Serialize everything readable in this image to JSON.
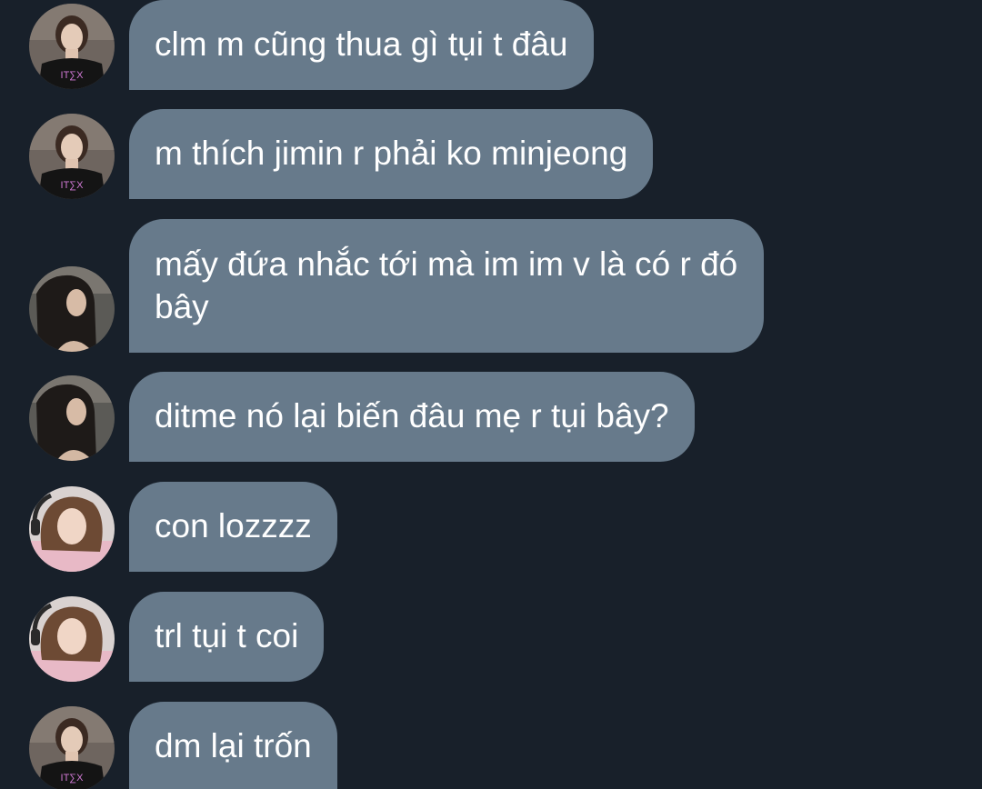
{
  "messages": [
    {
      "text": "clm m cũng thua gì tụi t đâu",
      "avatar": "avatar-black-tee-girl"
    },
    {
      "text": "m thích jimin r phải ko minjeong",
      "avatar": "avatar-black-tee-girl"
    },
    {
      "text": "mấy đứa nhắc tới mà im im v là có r đó bây",
      "avatar": "avatar-dark-hair-girl"
    },
    {
      "text": "ditme nó lại biến đâu mẹ r tụi bây?",
      "avatar": "avatar-dark-hair-girl"
    },
    {
      "text": "con lozzzz",
      "avatar": "avatar-headset-girl"
    },
    {
      "text": "trl tụi t coi",
      "avatar": "avatar-headset-girl"
    },
    {
      "text": "dm lại trốn",
      "avatar": "avatar-black-tee-girl"
    }
  ],
  "colors": {
    "background": "#18202a",
    "bubble": "#677a8b",
    "text": "#ffffff"
  }
}
